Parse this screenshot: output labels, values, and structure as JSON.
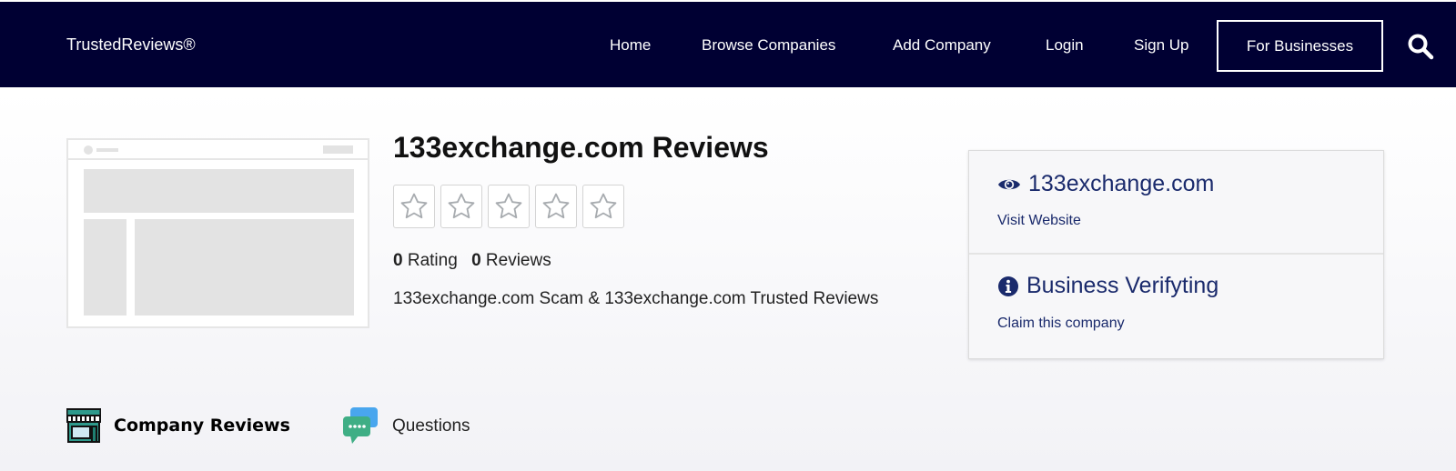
{
  "header": {
    "brand": "TrustedReviews®",
    "nav": [
      "Home",
      "Browse Companies",
      "Add Company",
      "Login",
      "Sign Up"
    ],
    "for_business": "For Businesses",
    "search_icon": "search-icon"
  },
  "company": {
    "title": "133exchange.com Reviews",
    "rating_count": "0",
    "rating_label": "Rating",
    "reviews_count": "0",
    "reviews_label": "Reviews",
    "tagline": "133exchange.com Scam & 133exchange.com Trusted Reviews",
    "stars": {
      "filled": 0,
      "total": 5
    }
  },
  "panel": {
    "website": "133exchange.com",
    "visit_label": "Visit Website",
    "verify_title": "Business Verifyting",
    "claim_label": "Claim this company"
  },
  "tabs": [
    {
      "label": "Company Reviews",
      "icon": "storefront-icon"
    },
    {
      "label": "Questions",
      "icon": "chat-bubbles-icon"
    }
  ],
  "colors": {
    "nav_bg": "#000033",
    "accent": "#1a2a6c"
  }
}
